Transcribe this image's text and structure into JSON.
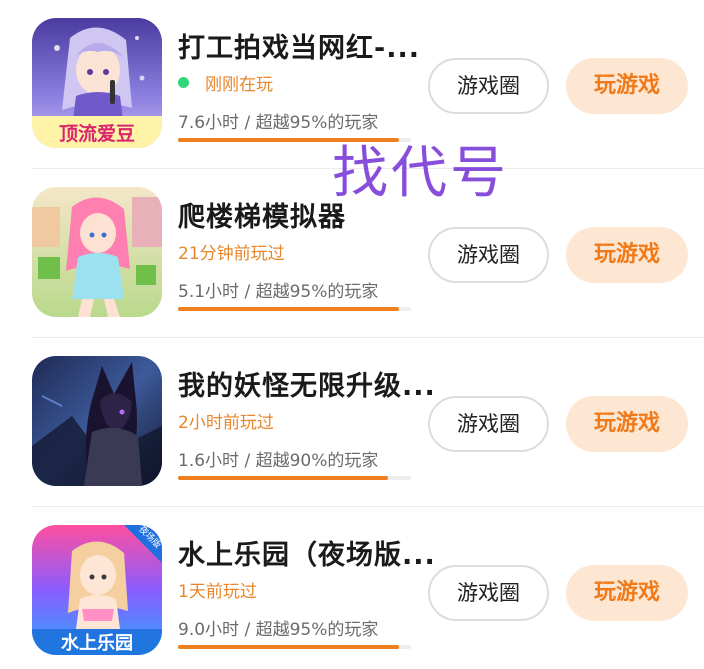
{
  "games": [
    {
      "title": "打工拍戏当网红-...",
      "status": "刚刚在玩",
      "online": true,
      "stats": "7.6小时 / 超越95%的玩家",
      "progress_percent": 95,
      "circle_label": "游戏圈",
      "play_label": "玩游戏",
      "thumb_text": "顶流爱豆",
      "thumb_icon": "idol-singer-icon"
    },
    {
      "title": "爬楼梯模拟器",
      "status": "21分钟前玩过",
      "online": false,
      "stats": "5.1小时 / 超越95%的玩家",
      "progress_percent": 95,
      "circle_label": "游戏圈",
      "play_label": "玩游戏",
      "thumb_text": "",
      "thumb_icon": "pink-hair-girl-icon"
    },
    {
      "title": "我的妖怪无限升级...",
      "status": "2小时前玩过",
      "online": false,
      "stats": "1.6小时 / 超越90%的玩家",
      "progress_percent": 90,
      "circle_label": "游戏圈",
      "play_label": "玩游戏",
      "thumb_text": "",
      "thumb_icon": "dark-fox-warrior-icon"
    },
    {
      "title": "水上乐园（夜场版...",
      "status": "1天前玩过",
      "online": false,
      "stats": "9.0小时 / 超越95%的玩家",
      "progress_percent": 95,
      "circle_label": "游戏圈",
      "play_label": "玩游戏",
      "thumb_text": "水上乐园",
      "thumb_badge": "夜场版",
      "thumb_icon": "water-park-girl-icon"
    }
  ],
  "watermark": "找代号",
  "colors": {
    "accent": "#f07a1a",
    "play_button_bg": "#fde7d3",
    "online_dot": "#2fd67a",
    "watermark": "#7b3bd8"
  }
}
